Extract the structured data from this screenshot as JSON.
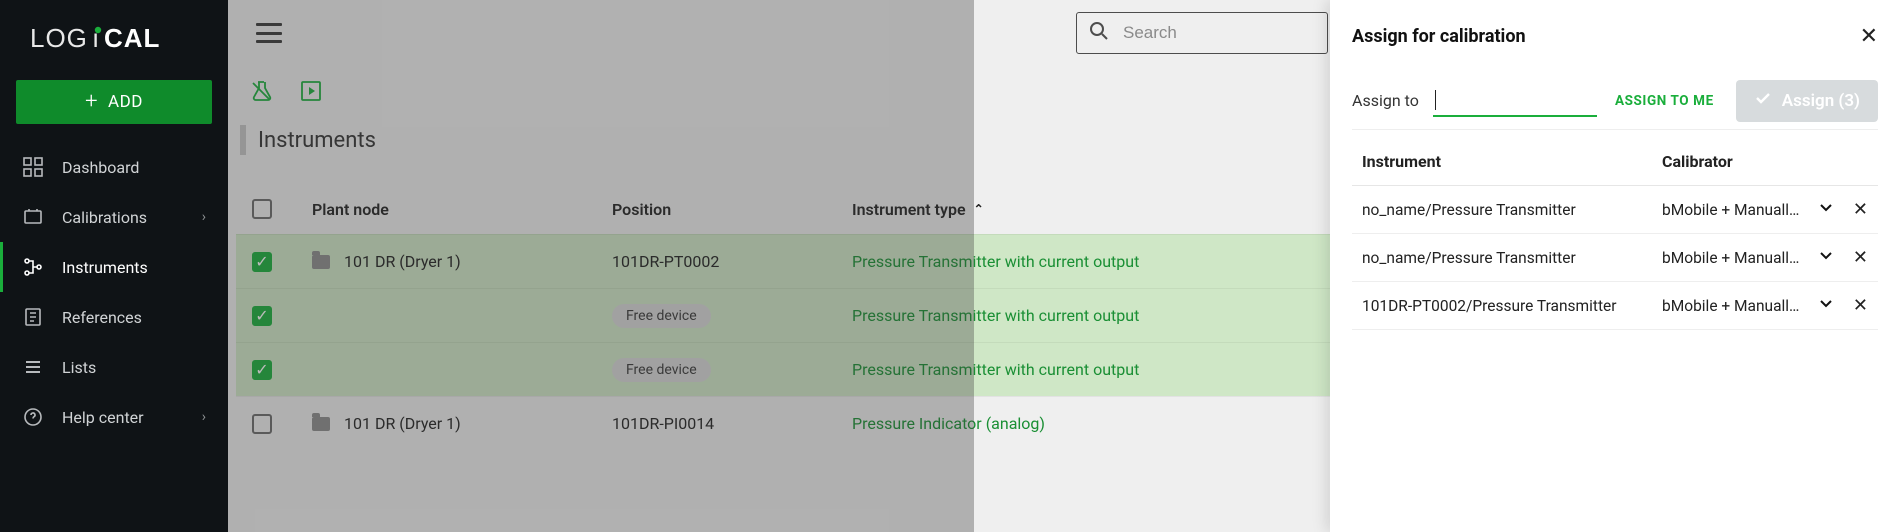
{
  "brand": {
    "name": "LOGiCAL"
  },
  "sidebar": {
    "add_label": "ADD",
    "items": [
      {
        "label": "Dashboard"
      },
      {
        "label": "Calibrations",
        "chevron": true
      },
      {
        "label": "Instruments",
        "active": true
      },
      {
        "label": "References"
      },
      {
        "label": "Lists"
      },
      {
        "label": "Help center",
        "chevron": true
      }
    ]
  },
  "header": {
    "search_placeholder": "Search"
  },
  "toolbar": {
    "assign_label": "Assign for calibration"
  },
  "page": {
    "title": "Instruments"
  },
  "table": {
    "cols": {
      "node": "Plant node",
      "position": "Position",
      "type": "Instrument type"
    },
    "rows": [
      {
        "selected": true,
        "node": "101 DR (Dryer 1)",
        "position": "101DR-PT0002",
        "type": "Pressure Transmitter with current output",
        "free": false,
        "folder": true
      },
      {
        "selected": true,
        "node": "",
        "position": "Free device",
        "type": "Pressure Transmitter with current output",
        "free": true,
        "folder": false
      },
      {
        "selected": true,
        "node": "",
        "position": "Free device",
        "type": "Pressure Transmitter with current output",
        "free": true,
        "folder": false
      },
      {
        "selected": false,
        "node": "101 DR (Dryer 1)",
        "position": "101DR-PI0014",
        "type": "Pressure Indicator (analog)",
        "free": false,
        "folder": true
      }
    ]
  },
  "panel": {
    "title": "Assign for calibration",
    "assign_to_label": "Assign to",
    "assign_me": "ASSIGN TO ME",
    "assign_btn": "Assign (3)",
    "cols": {
      "instr": "Instrument",
      "cal": "Calibrator"
    },
    "rows": [
      {
        "instr": "no_name/Pressure Transmitter",
        "cal": "bMobile + Manuall…"
      },
      {
        "instr": "no_name/Pressure Transmitter",
        "cal": "bMobile + Manuall…"
      },
      {
        "instr": "101DR-PT0002/Pressure Transmitter",
        "cal": "bMobile + Manuall…"
      }
    ]
  }
}
